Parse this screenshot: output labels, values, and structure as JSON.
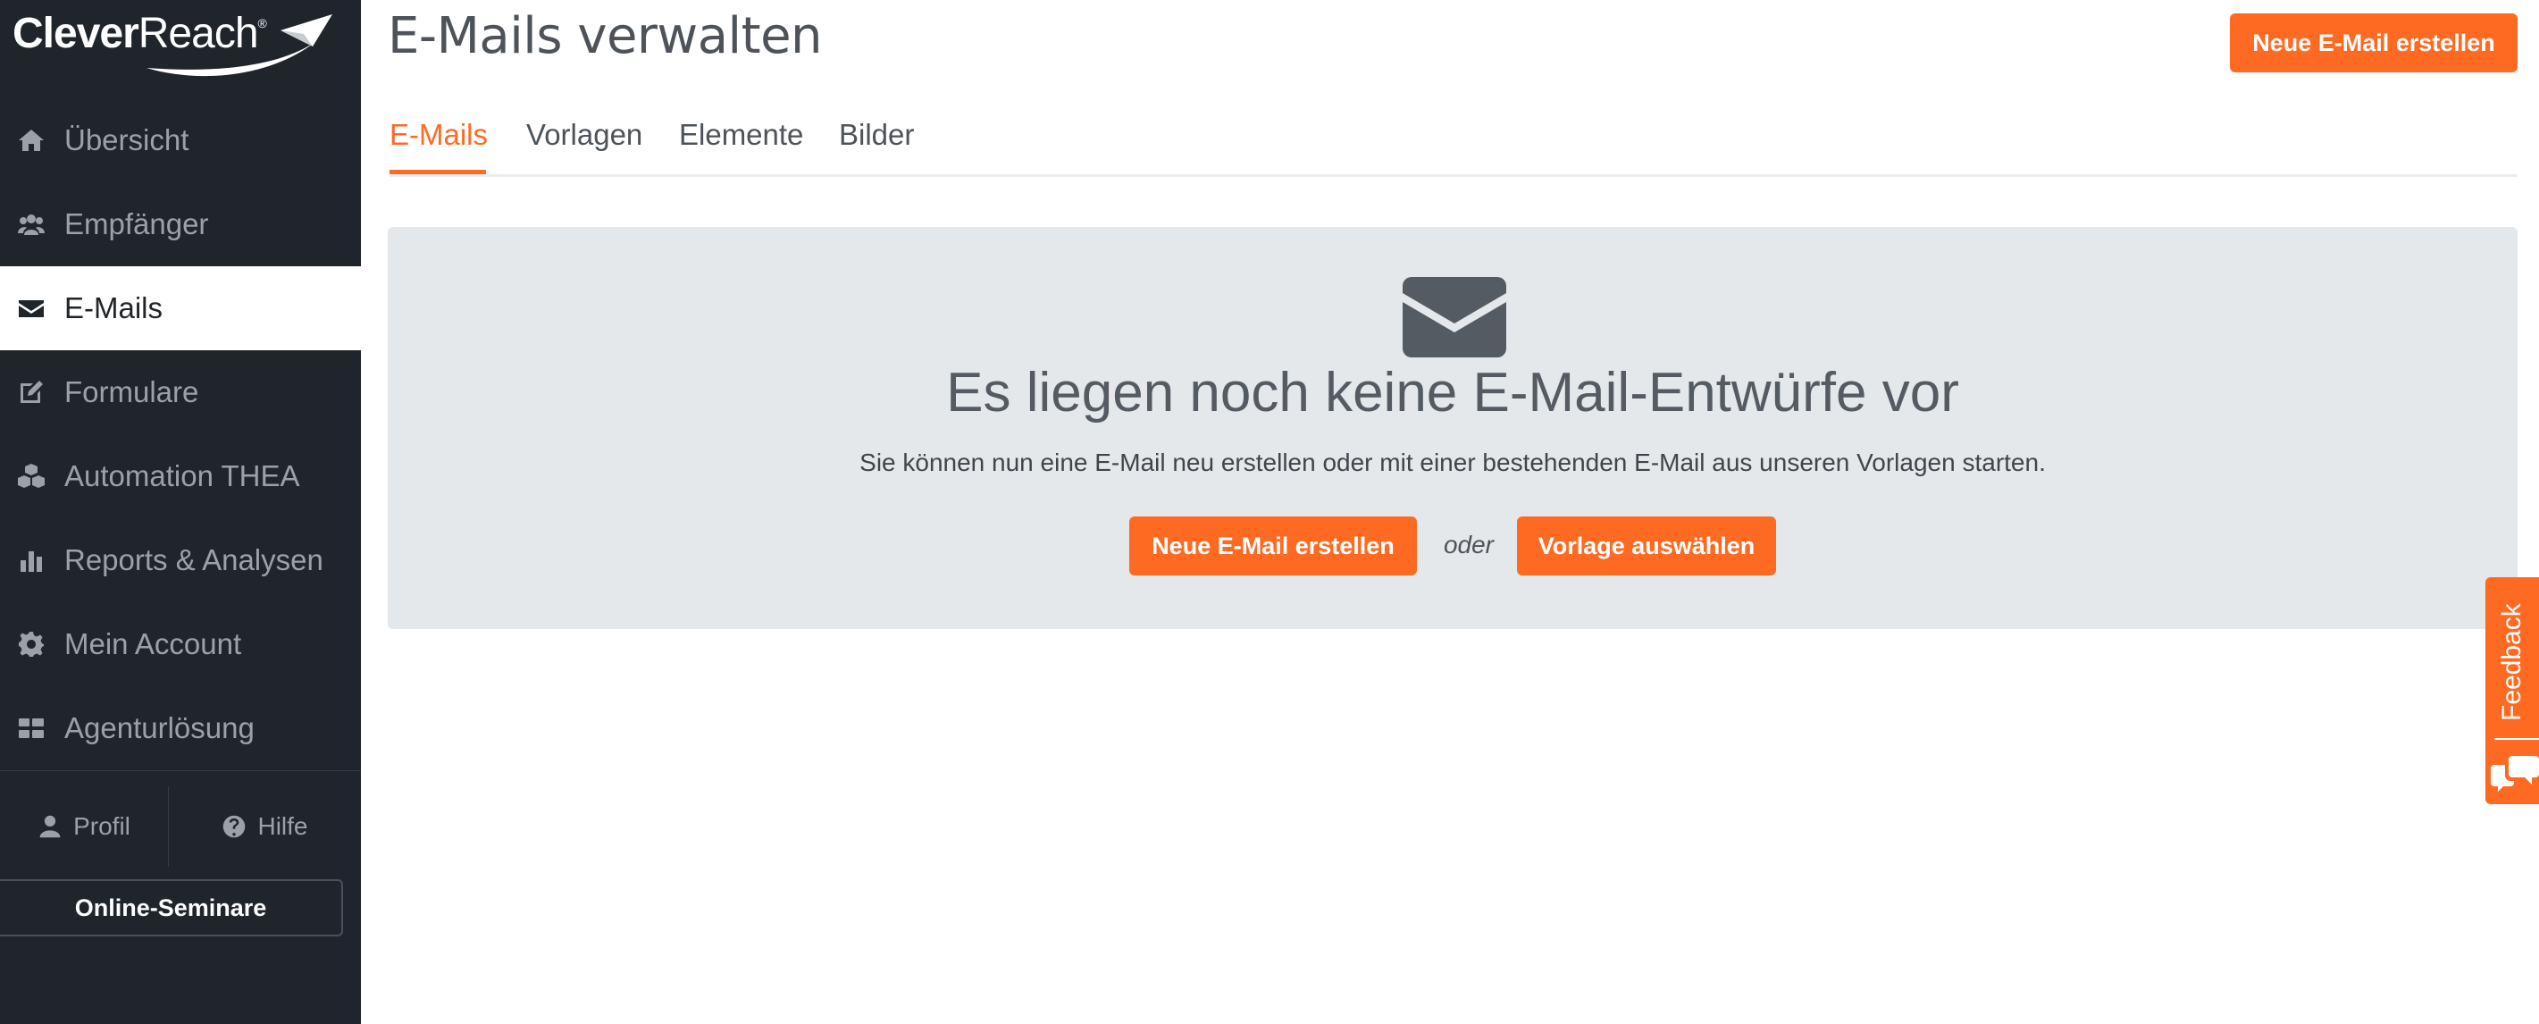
{
  "brand": {
    "name_bold": "Clever",
    "name_light": "Reach",
    "registered": "®"
  },
  "sidebar": {
    "items": [
      {
        "label": "Übersicht",
        "icon": "home-icon"
      },
      {
        "label": "Empfänger",
        "icon": "users-icon"
      },
      {
        "label": "E-Mails",
        "icon": "envelope-icon",
        "active": true
      },
      {
        "label": "Formulare",
        "icon": "edit-icon"
      },
      {
        "label": "Automation THEA",
        "icon": "cubes-icon"
      },
      {
        "label": "Reports & Analysen",
        "icon": "bar-chart-icon"
      },
      {
        "label": "Mein Account",
        "icon": "gear-icon"
      },
      {
        "label": "Agenturlösung",
        "icon": "grid-icon"
      }
    ],
    "profil_label": "Profil",
    "hilfe_label": "Hilfe",
    "seminar_label": "Online-Seminare"
  },
  "header": {
    "title": "E-Mails verwalten",
    "new_email_label": "Neue E-Mail erstellen"
  },
  "tabs": [
    {
      "label": "E-Mails",
      "active": true
    },
    {
      "label": "Vorlagen"
    },
    {
      "label": "Elemente"
    },
    {
      "label": "Bilder"
    }
  ],
  "empty_state": {
    "icon": "envelope-icon",
    "title": "Es liegen noch keine E-Mail-Entwürfe vor",
    "description": "Sie können nun eine E-Mail neu erstellen oder mit einer bestehenden E-Mail aus unseren Vorlagen starten.",
    "new_email_label": "Neue E-Mail erstellen",
    "or_label": "oder",
    "template_label": "Vorlage auswählen"
  },
  "feedback": {
    "label": "Feedback",
    "icon": "chat-icon"
  },
  "colors": {
    "sidebar_bg": "#1f252b",
    "accent": "#ff6a22",
    "panel_bg": "#e4e8eb",
    "text": "#555b62"
  }
}
